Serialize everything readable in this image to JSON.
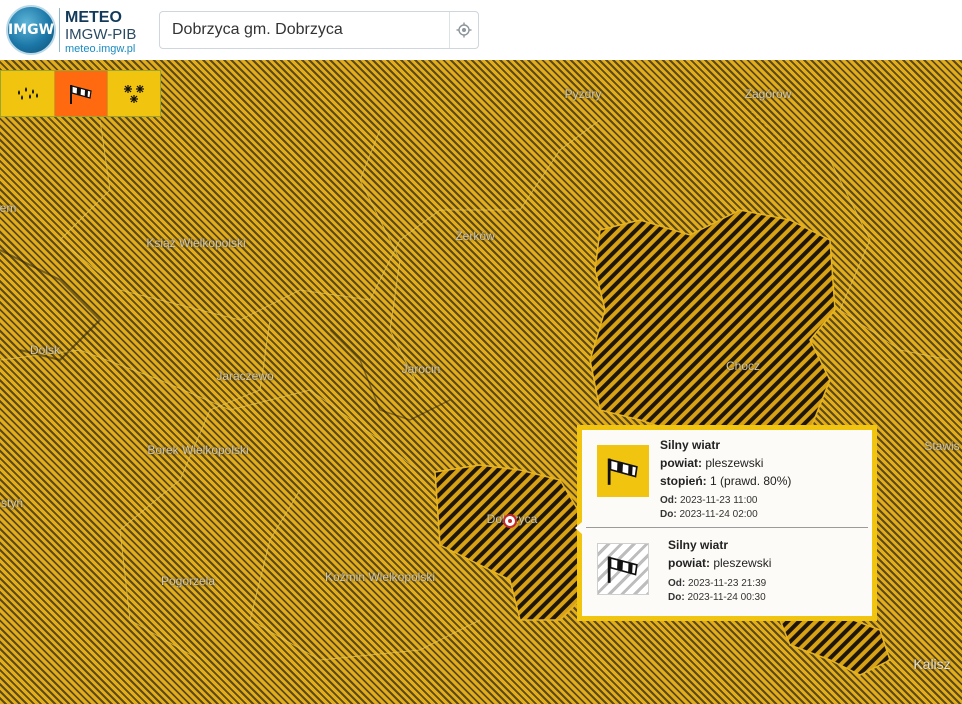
{
  "header": {
    "logo_badge": "IMGW",
    "logo_title": "METEO",
    "logo_subtitle": "IMGW-PIB",
    "logo_url": "meteo.imgw.pl",
    "search_value": "Dobrzyca gm. Dobrzyca",
    "locate_icon": "crosshair-icon"
  },
  "phenomena": [
    {
      "name": "rain-icon",
      "color": "#f1c40f"
    },
    {
      "name": "windsock-icon",
      "color": "#ff6a10"
    },
    {
      "name": "snow-icon",
      "color": "#f1c40f"
    }
  ],
  "map": {
    "places": [
      {
        "label": "Pyzdry"
      },
      {
        "label": "Zagórów"
      },
      {
        "label": "em"
      },
      {
        "label": "Książ Wielkopolski"
      },
      {
        "label": "Żerków"
      },
      {
        "label": "Dolsk"
      },
      {
        "label": "Jaraczewo"
      },
      {
        "label": "Jarocin"
      },
      {
        "label": "Chocz"
      },
      {
        "label": "Borek Wielkopolski"
      },
      {
        "label": "Stawis"
      },
      {
        "label": "styń"
      },
      {
        "label": "Dobrzyca"
      },
      {
        "label": "Pogorzela"
      },
      {
        "label": "Koźmin Wielkopolski"
      },
      {
        "label": "Kalisz"
      }
    ],
    "colors": {
      "warning_yellow": "#f1c40f",
      "warning_orange": "#ff6a10",
      "hatch_dark": "#5a4a1e"
    }
  },
  "popup": {
    "active": {
      "title": "Silny wiatr",
      "powiat_label": "powiat:",
      "powiat_value": "pleszewski",
      "stopien_label": "stopień:",
      "stopien_value": "1 (prawd. 80%)",
      "od_label": "Od:",
      "od_value": "2023-11-23 11:00",
      "do_label": "Do:",
      "do_value": "2023-11-24 02:00"
    },
    "inactive": {
      "title": "Silny wiatr",
      "powiat_label": "powiat:",
      "powiat_value": "pleszewski",
      "od_label": "Od:",
      "od_value": "2023-11-23 21:39",
      "do_label": "Do:",
      "do_value": "2023-11-24 00:30"
    }
  }
}
